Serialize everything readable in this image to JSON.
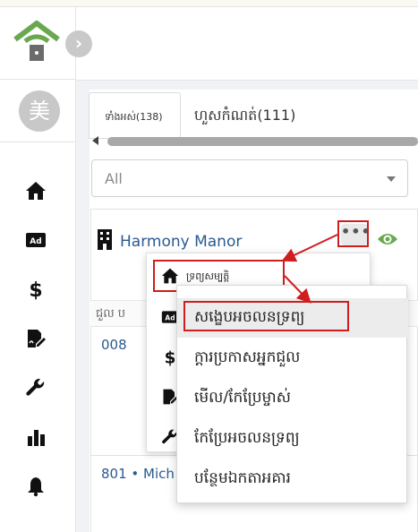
{
  "sidebar": {
    "avatar_text": "美",
    "nav_icons": [
      "home-icon",
      "ad-icon",
      "dollar-icon",
      "document-edit-icon",
      "wrench-icon",
      "bar-chart-icon",
      "bell-icon"
    ],
    "brand_color": "#6aa84f"
  },
  "tabs": {
    "all_label": "ទាំងអស់(138)",
    "expired_label": "ហួសកំណត់(111)"
  },
  "filter": {
    "selected": "All"
  },
  "property": {
    "name": "Harmony Manor",
    "more_label": "•••"
  },
  "table": {
    "column_header": "ជួល ប",
    "rows": [
      {
        "unit": "008"
      },
      {
        "unit": "801 • Mich"
      }
    ]
  },
  "menu": {
    "items": [
      {
        "label": "ទ្រព្យសម្បត្តិ",
        "icon": "home-icon"
      },
      {
        "label": "",
        "icon": "ad-icon"
      },
      {
        "label": "",
        "icon": "dollar-icon"
      },
      {
        "label": "",
        "icon": "document-edit-icon"
      },
      {
        "label": "",
        "icon": "wrench-icon"
      }
    ]
  },
  "submenu": {
    "items": [
      {
        "label": "សង្ខេបអចលនទ្រព្យ"
      },
      {
        "label": "ក្តារប្រកាសអ្នកជួល"
      },
      {
        "label": "មើល/កែប្រែម្ចាស់"
      },
      {
        "label": "កែប្រែអចលនទ្រព្យ"
      },
      {
        "label": "បន្ថែមឯកតាអគារ"
      }
    ]
  },
  "colors": {
    "accent": "#2b5a8f",
    "highlight_red": "#d01d1d",
    "eye_green": "#6aa84f"
  }
}
